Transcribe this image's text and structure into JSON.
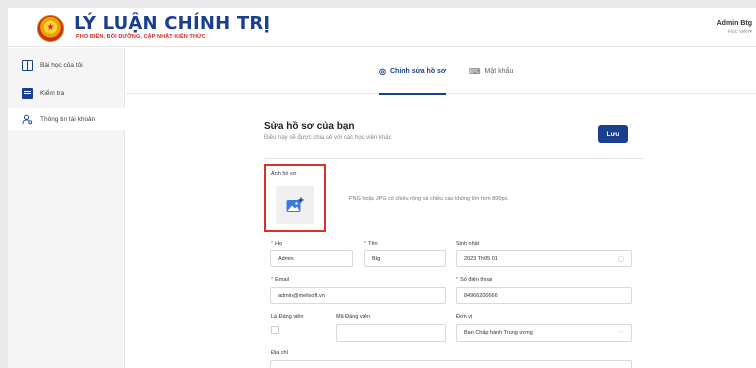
{
  "header": {
    "title": "LÝ LUẬN CHÍNH TRỊ",
    "subtitle": "PHỔ BIẾN, BỒI DƯỠNG, CẬP NHẬT KIẾN THỨC",
    "user_name": "Admin Btg",
    "user_role": "Học viên▾"
  },
  "sidebar": {
    "items": [
      {
        "label": "Bài học của tôi",
        "icon": "book-icon"
      },
      {
        "label": "Kiểm tra",
        "icon": "test-icon"
      },
      {
        "label": "Thông tin tài khoản",
        "icon": "user-settings-icon"
      }
    ]
  },
  "tabs": [
    {
      "label": "Chỉnh sửa hồ sơ",
      "icon": "profile-icon"
    },
    {
      "label": "Mật khẩu",
      "icon": "key-icon"
    }
  ],
  "form": {
    "title": "Sửa hồ sơ của bạn",
    "subtitle": "Điều này sẽ được chia sẻ với các học viên khác",
    "save_label": "Lưu",
    "avatar_label": "Ảnh hồ sơ",
    "avatar_hint": "PNG hoặc JPG có chiều rộng và chiều cao không lớn hơn 800px.",
    "ho_label": "Họ",
    "ho_value": "Admin",
    "ten_label": "Tên",
    "ten_value": "Btg",
    "birthday_label": "Sinh nhật",
    "birthday_value": "2023 Th05 01",
    "email_label": "Email",
    "email_value": "admin@melisoft.vn",
    "phone_label": "Số điện thoại",
    "phone_value": "84966200666",
    "party_member_label": "Là Đảng viên",
    "party_code_label": "Mã Đảng viên",
    "party_code_value": "",
    "unit_label": "Đơn vị",
    "unit_value": "Ban Chấp hành Trung ương",
    "address_label": "Địa chỉ",
    "address_value": ""
  },
  "colors": {
    "brand": "#1a3f8f",
    "highlight": "#d9302a",
    "required": "#e0403a"
  }
}
